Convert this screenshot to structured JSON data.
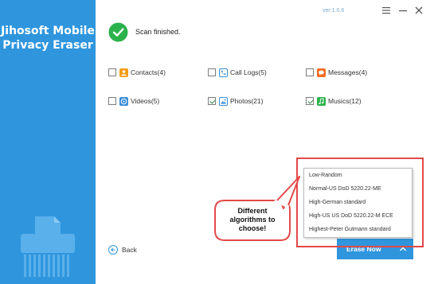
{
  "app": {
    "title_line1": "Jihosoft Mobile",
    "title_line2": "Privacy Eraser",
    "version": "ver:1.0.6"
  },
  "status": {
    "text": "Scan finished."
  },
  "categories": [
    {
      "label": "Contacts(4)",
      "checked": false,
      "icon": "contacts-icon",
      "color": "#f39c12"
    },
    {
      "label": "Call Logs(5)",
      "checked": false,
      "icon": "call-logs-icon",
      "color": "#3a8fd6"
    },
    {
      "label": "Messages(4)",
      "checked": false,
      "icon": "messages-icon",
      "color": "#f26c22"
    },
    {
      "label": "Videos(5)",
      "checked": false,
      "icon": "videos-icon",
      "color": "#3a8fd6"
    },
    {
      "label": "Photos(21)",
      "checked": true,
      "icon": "photos-icon",
      "color": "#3a8fd6"
    },
    {
      "label": "Musics(12)",
      "checked": true,
      "icon": "musics-icon",
      "color": "#2bb24c"
    }
  ],
  "algorithm_menu": {
    "items": [
      "Low-Random",
      "Normal-US DoD 5220.22-ME",
      "High-German standard",
      "High-US US DoD 5220.22-M ECE",
      "Highest-Peter Gutmann standard"
    ]
  },
  "callout": {
    "line1": "Different",
    "line2": "algorithms to",
    "line3": "choose!"
  },
  "buttons": {
    "back": "Back",
    "erase": "Erase Now"
  },
  "colors": {
    "sidebar": "#2f96de",
    "accent": "#2f96de",
    "success": "#2bb24c",
    "highlight": "#e34848"
  }
}
